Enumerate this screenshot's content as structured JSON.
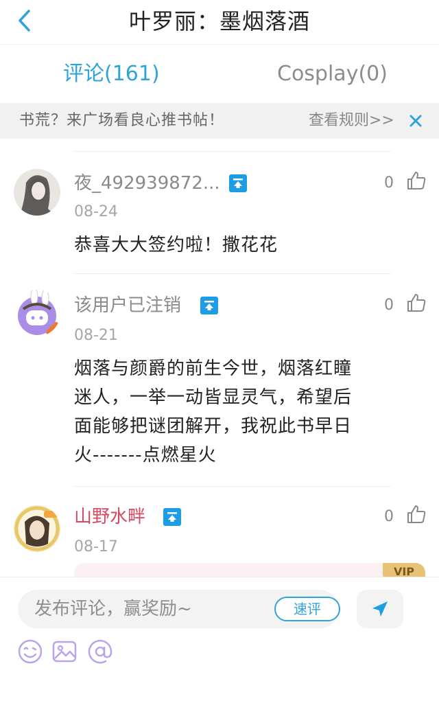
{
  "header": {
    "title": "叶罗丽：墨烟落酒"
  },
  "tabs": [
    {
      "label": "评论(161)",
      "active": true
    },
    {
      "label": "Cosplay(0)",
      "active": false
    }
  ],
  "notice": {
    "text": "书荒？来广场看良心推书帖！",
    "rules_link": "查看规则>>",
    "close_icon": "close-icon"
  },
  "comments": [
    {
      "username": "夜_492939872...",
      "date": "08-24",
      "likes": "0",
      "content_lines": [
        "恭喜大大签约啦！撒花花"
      ]
    },
    {
      "username": "该用户已注销",
      "date": "08-21",
      "likes": "0",
      "content_lines": [
        "烟落与颜爵的前生今世，烟落红瞳",
        "迷人，一举一动皆显灵气，希望后",
        "面能够把谜团解开，我祝此书早日",
        "火-------点燃星火"
      ]
    },
    {
      "username": "山野水畔",
      "date": "08-17",
      "likes": "0",
      "author": true,
      "vip_tag": "VIP"
    }
  ],
  "composer": {
    "placeholder": "发布评论，赢奖励~",
    "quick_review_label": "速评",
    "tools": [
      "emoji-icon",
      "image-icon",
      "at-icon"
    ]
  },
  "colors": {
    "accent": "#2fa3dc",
    "badge": "#1e9de5",
    "author_name": "#d9485f",
    "vip_bg": "#fdf0f2",
    "vip_tag": "#e8c376"
  }
}
